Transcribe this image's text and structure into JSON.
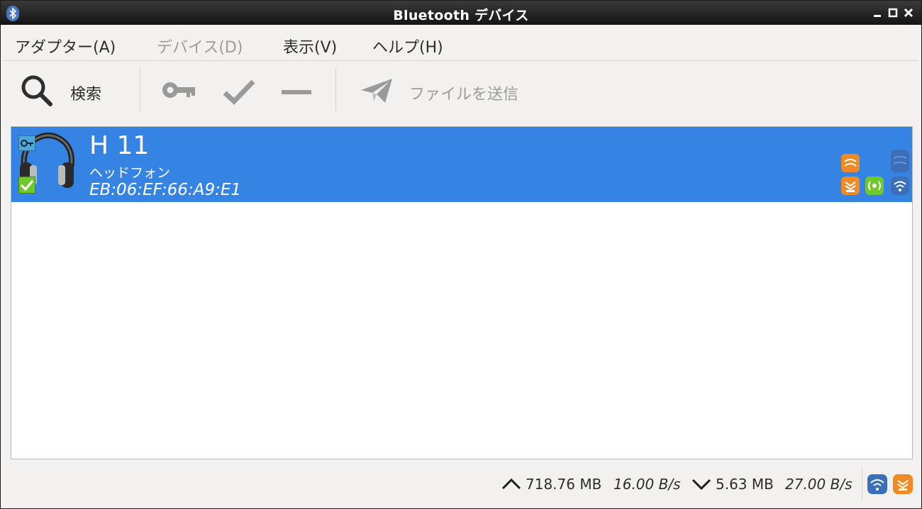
{
  "window": {
    "title": "Bluetooth デバイス"
  },
  "menubar": {
    "adapter": "アダプター(A)",
    "device": "デバイス(D)",
    "view": "表示(V)",
    "help": "ヘルプ(H)"
  },
  "toolbar": {
    "search_label": "検索",
    "send_file_label": "ファイルを送信"
  },
  "devices": [
    {
      "name": "H 11",
      "type": "ヘッドフォン",
      "address": "EB:06:EF:66:A9:E1",
      "paired": true,
      "trusted": true
    }
  ],
  "status": {
    "upload_total": "718.76 MB",
    "upload_rate": "16.00 B/s",
    "download_total": "5.63 MB",
    "download_rate": "27.00 B/s"
  },
  "colors": {
    "selection": "#3584e4",
    "titlebar": "#1e1e1e",
    "accent_orange": "#f08a24",
    "accent_green": "#6fc82c",
    "accent_blue": "#3d6fb8"
  }
}
